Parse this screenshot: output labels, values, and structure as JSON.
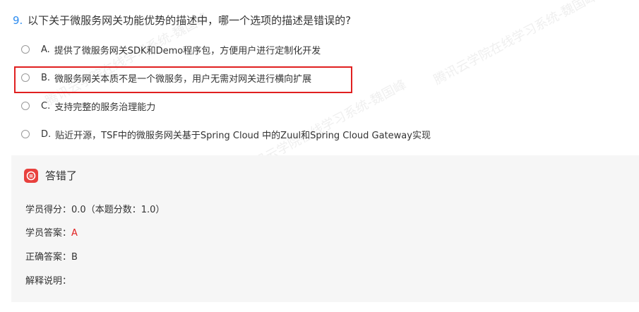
{
  "question": {
    "number": "9.",
    "text": "以下关于微服务网关功能优势的描述中，哪一个选项的描述是错误的?"
  },
  "options": [
    {
      "letter": "A.",
      "text": "提供了微服务网关SDK和Demo程序包，方便用户进行定制化开发"
    },
    {
      "letter": "B.",
      "text": "微服务网关本质不是一个微服务，用户无需对网关进行横向扩展"
    },
    {
      "letter": "C.",
      "text": "支持完整的服务治理能力"
    },
    {
      "letter": "D.",
      "text": "贴近开源，TSF中的微服务网关基于Spring Cloud 中的Zuul和Spring Cloud Gateway实现"
    }
  ],
  "result": {
    "title": "答错了",
    "score_label": "学员得分：",
    "score_value": "0.0（本题分数：1.0）",
    "student_answer_label": "学员答案：",
    "student_answer_value": "A",
    "correct_answer_label": "正确答案：",
    "correct_answer_value": "B",
    "explanation_label": "解释说明："
  },
  "watermark": "腾讯云学院在线学习系统-魏国峰",
  "colors": {
    "accent_blue": "#2d8cf0",
    "wrong_red": "#e8413e",
    "highlight_red": "#e02020"
  }
}
